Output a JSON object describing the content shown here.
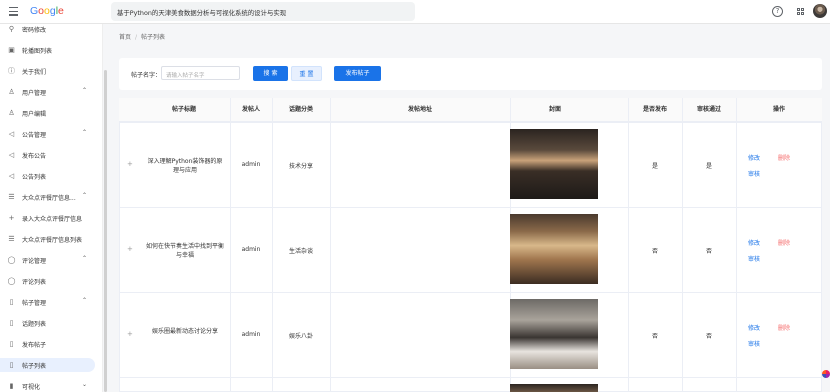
{
  "header": {
    "logo": "Google",
    "title": "基于Python的天津美食数据分析与可视化系统的设计与实现"
  },
  "sidebar": {
    "items": [
      {
        "label": "密码修改",
        "icon": "key-icon",
        "chev": ""
      },
      {
        "label": "轮播图列表",
        "icon": "image-icon",
        "chev": ""
      },
      {
        "label": "关于我们",
        "icon": "info-icon",
        "chev": ""
      },
      {
        "label": "用户管理",
        "icon": "user-icon",
        "chev": "up"
      },
      {
        "label": "用户编辑",
        "icon": "user-icon",
        "chev": ""
      },
      {
        "label": "公告管理",
        "icon": "megaphone-icon",
        "chev": "up"
      },
      {
        "label": "发布公告",
        "icon": "megaphone-icon",
        "chev": ""
      },
      {
        "label": "公告列表",
        "icon": "megaphone-icon",
        "chev": ""
      },
      {
        "label": "大众点评餐厅信息...",
        "icon": "list-icon",
        "chev": "up"
      },
      {
        "label": "录入大众点评餐厅信息",
        "icon": "plus-icon",
        "chev": ""
      },
      {
        "label": "大众点评餐厅信息列表",
        "icon": "list-icon",
        "chev": ""
      },
      {
        "label": "评论管理",
        "icon": "comment-icon",
        "chev": "up"
      },
      {
        "label": "评论列表",
        "icon": "comment-icon",
        "chev": ""
      },
      {
        "label": "帖子管理",
        "icon": "document-icon",
        "chev": "up"
      },
      {
        "label": "话题列表",
        "icon": "document-icon",
        "chev": ""
      },
      {
        "label": "发布帖子",
        "icon": "document-icon",
        "chev": ""
      },
      {
        "label": "帖子列表",
        "icon": "document-icon",
        "chev": "",
        "active": true
      },
      {
        "label": "可视化",
        "icon": "chart-icon",
        "chev": "down"
      }
    ]
  },
  "breadcrumb": {
    "home": "首页",
    "current": "帖子列表"
  },
  "search": {
    "label": "帖子名字：",
    "placeholder": "请输入帖子名字",
    "search_button": "搜 索",
    "reset_button": "重 置",
    "post_button": "发布帖子"
  },
  "table": {
    "columns": [
      "帖子标题",
      "发帖人",
      "话题分类",
      "发帖地址",
      "封面",
      "是否发布",
      "审核通过",
      "操作"
    ],
    "rows": [
      {
        "title": "深入理解Python装饰器的原理与应用",
        "author": "admin",
        "topic": "技术分享",
        "address": "",
        "published": "是",
        "approved": "是",
        "image": "restaurant-interior"
      },
      {
        "title": "如何在快节奏生活中找到平衡与幸福",
        "author": "admin",
        "topic": "生活杂谈",
        "address": "",
        "published": "否",
        "approved": "否",
        "image": "restaurant-dining-hall"
      },
      {
        "title": "娱乐圈最新动态讨论分享",
        "author": "admin",
        "topic": "娱乐八卦",
        "address": "",
        "published": "否",
        "approved": "否",
        "image": "plated-dish"
      }
    ],
    "actions": {
      "edit": "修改",
      "delete": "删除",
      "audit": "审核"
    }
  }
}
